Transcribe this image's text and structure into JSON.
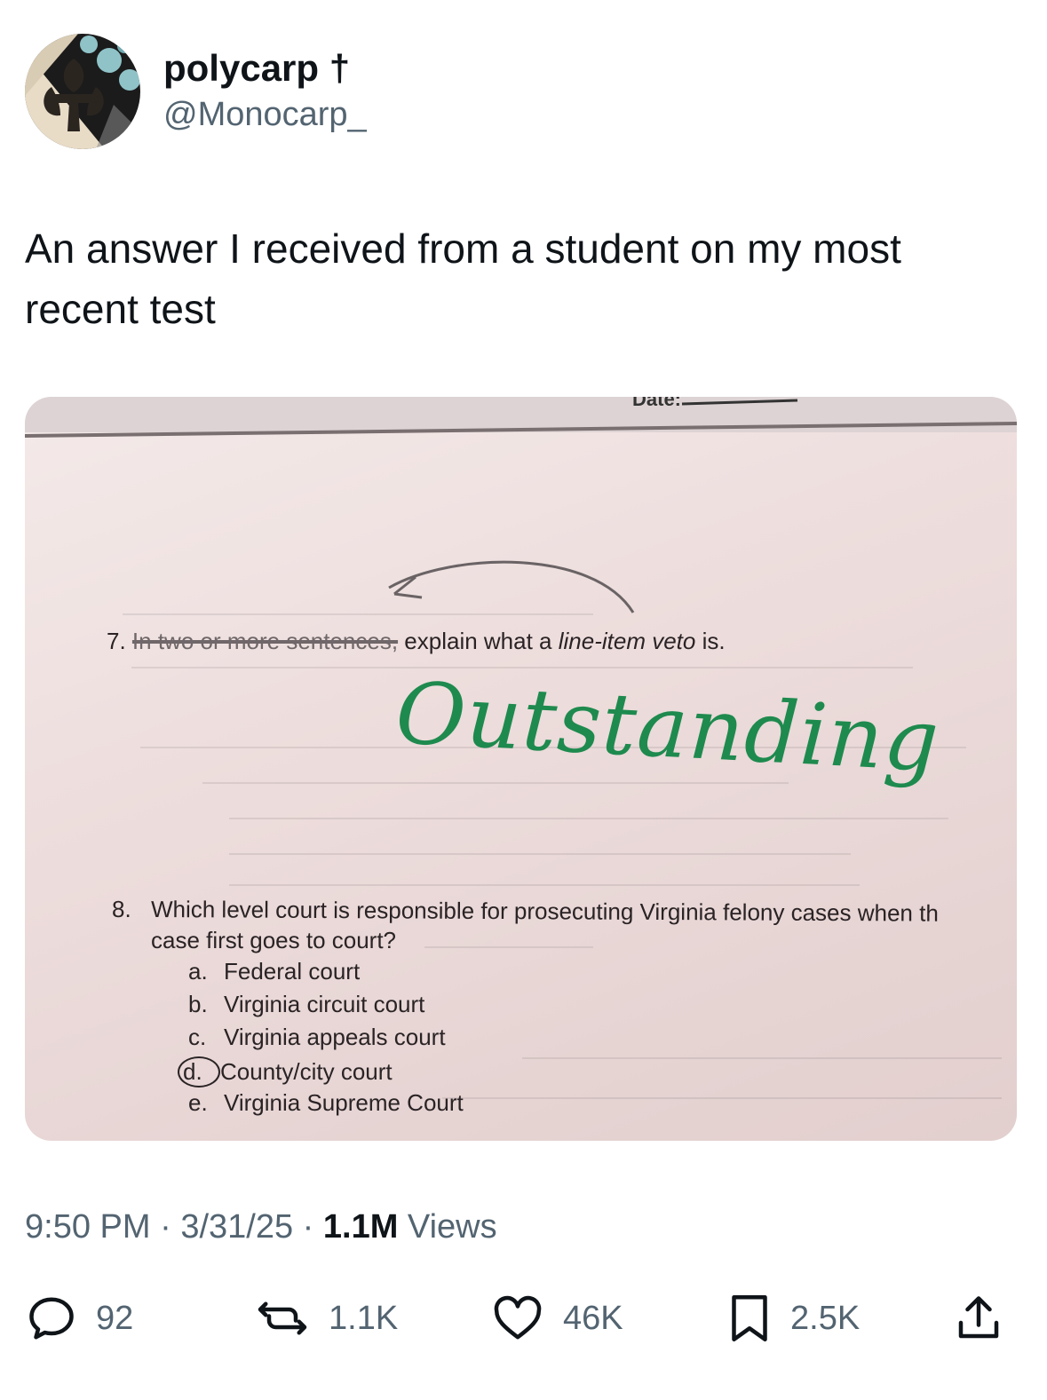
{
  "author": {
    "display_name": "polycarp †",
    "handle": "@Monocarp_"
  },
  "tweet": {
    "text": "An answer I received from a student on my most recent test"
  },
  "photo": {
    "header_fragment": "Date:",
    "q7": {
      "number": "7.",
      "struck_text": "In two or more sentences,",
      "text_before_italic": " explain what a ",
      "italic_text": "line-item veto",
      "text_after_italic": " is."
    },
    "handwritten_answer": "Outstanding",
    "q8": {
      "number": "8.",
      "line1": "Which level court is responsible for prosecuting Virginia felony cases when th",
      "line2": "case first goes to court?",
      "options": [
        {
          "letter": "a.",
          "text": "Federal court"
        },
        {
          "letter": "b.",
          "text": "Virginia circuit court"
        },
        {
          "letter": "c.",
          "text": "Virginia appeals court"
        },
        {
          "letter": "d.",
          "text": "County/city court",
          "circled": true
        },
        {
          "letter": "e.",
          "text": "Virginia Supreme Court"
        }
      ]
    }
  },
  "meta": {
    "time": "9:50 PM",
    "sep1": " · ",
    "date": "3/31/25",
    "sep2": " · ",
    "views_count": "1.1M",
    "views_label": " Views"
  },
  "actions": {
    "replies": "92",
    "reposts": "1.1K",
    "likes": "46K",
    "bookmarks": "2.5K"
  },
  "colors": {
    "ink_green": "#1e8a4e",
    "secondary_text": "#536471"
  }
}
